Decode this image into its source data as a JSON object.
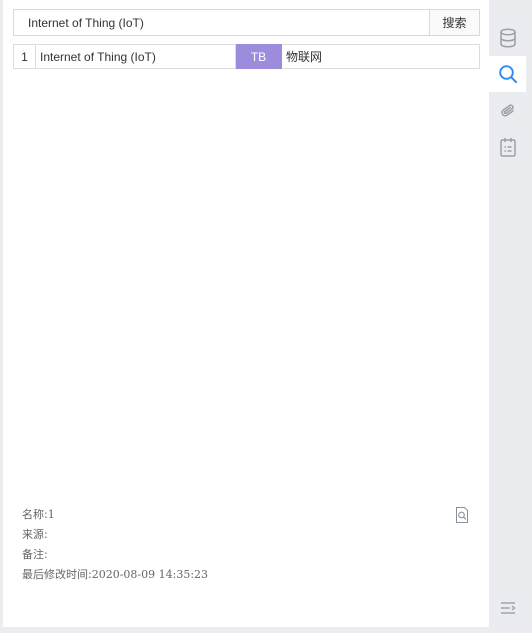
{
  "search": {
    "value": "Internet of Thing (IoT)",
    "button_label": "搜索"
  },
  "results": [
    {
      "index": "1",
      "term": "Internet of Thing (IoT)",
      "lang": "TB",
      "translation": "物联网"
    }
  ],
  "details": {
    "name_label": "名称:",
    "name_value": "1",
    "source_label": "来源:",
    "source_value": "",
    "note_label": "备注:",
    "note_value": "",
    "modified_label": "最后修改时间:",
    "modified_value": "2020-08-09 14:35:23"
  },
  "sidebar": {
    "items": [
      {
        "icon": "database-icon"
      },
      {
        "icon": "search-icon",
        "active": true
      },
      {
        "icon": "paperclip-icon"
      },
      {
        "icon": "clipboard-list-icon"
      }
    ],
    "bottom_icon": "menu-collapse-icon"
  },
  "colors": {
    "accent": "#2d8cf0",
    "lang_tag_bg": "#9d8cdc",
    "icon_gray": "#9aa0a8"
  }
}
